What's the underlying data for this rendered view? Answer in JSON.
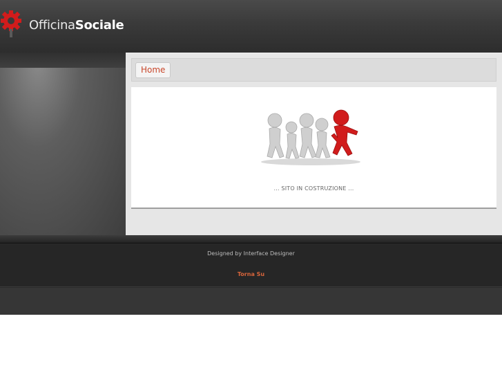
{
  "header": {
    "logo_part1": "Officina",
    "logo_part2": "Sociale"
  },
  "nav": {
    "home_label": "Home"
  },
  "main": {
    "construction_text": "... SITO IN COSTRUZIONE ..."
  },
  "footer": {
    "designer_text": "Designed by Interface Designer",
    "back_to_top": "Torna Su"
  },
  "colors": {
    "accent": "#c8462a",
    "logo_red": "#d11c1c",
    "header_bg": "#3a3a3a",
    "footer_bg": "#2a2a2a"
  },
  "icons": {
    "logo": "gear-icon",
    "hero": "running-figures-illustration"
  }
}
